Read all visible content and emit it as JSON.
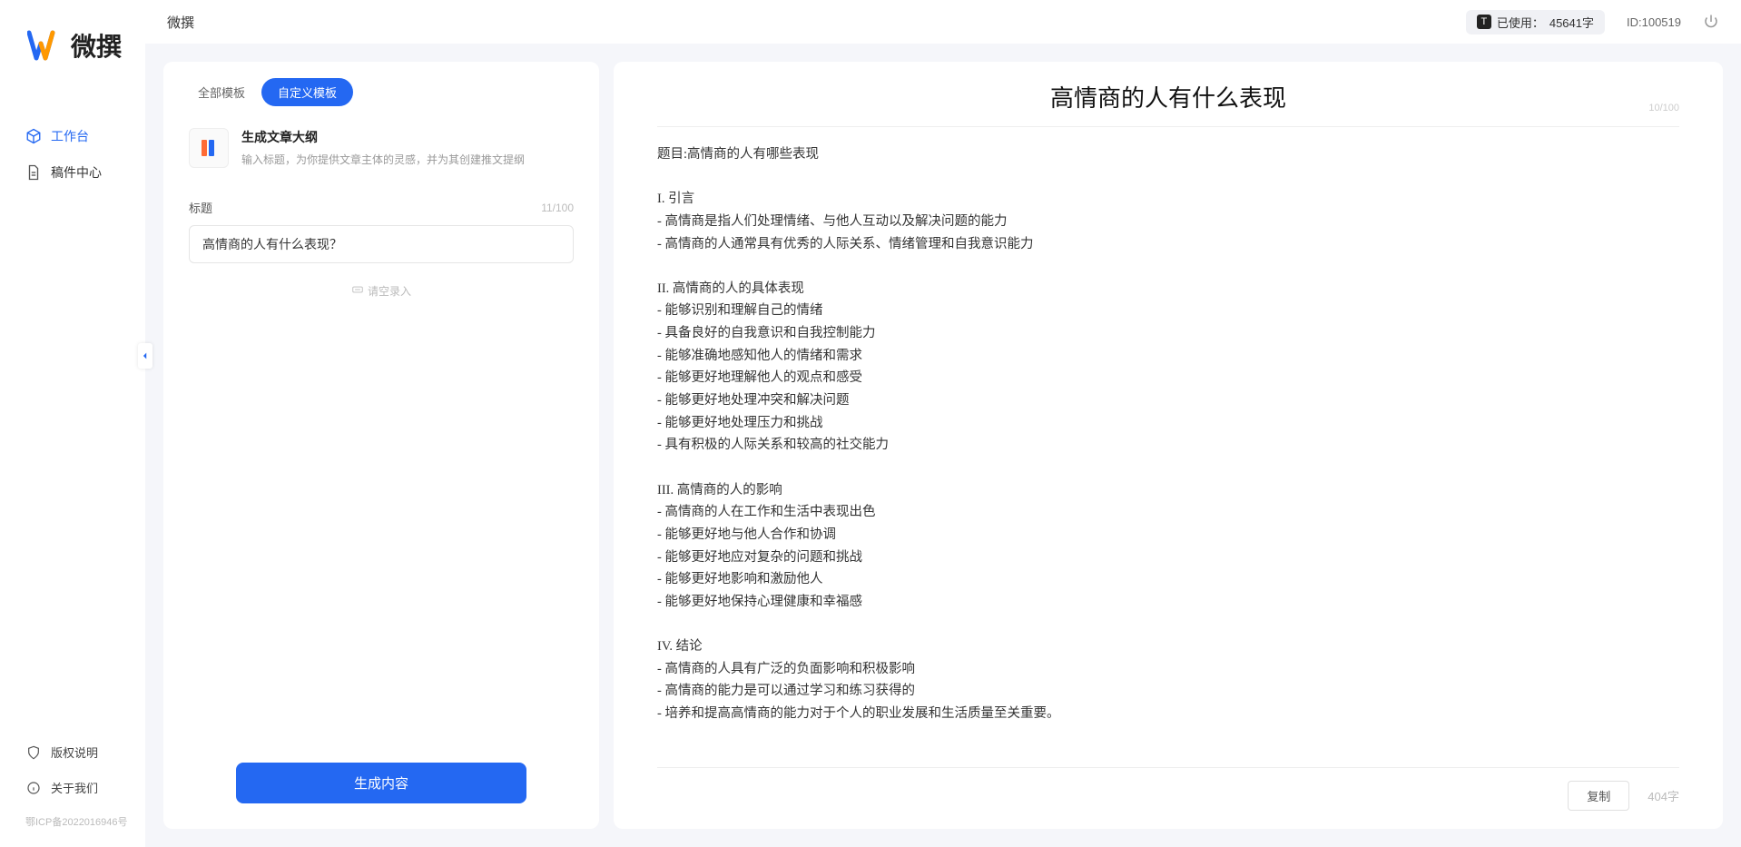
{
  "brand": {
    "name": "微撰"
  },
  "sidebar": {
    "nav": [
      {
        "label": "工作台",
        "active": true,
        "icon": "cube"
      },
      {
        "label": "稿件中心",
        "active": false,
        "icon": "doc"
      }
    ],
    "bottom": [
      {
        "label": "版权说明",
        "icon": "shield"
      },
      {
        "label": "关于我们",
        "icon": "info"
      }
    ],
    "icp": "鄂ICP备2022016946号"
  },
  "topbar": {
    "title": "微撰",
    "usage_prefix": "已使用：",
    "usage_value": "45641字",
    "userid": "ID:100519"
  },
  "left": {
    "tabs": [
      {
        "label": "全部模板",
        "active": false
      },
      {
        "label": "自定义模板",
        "active": true
      }
    ],
    "template": {
      "name": "生成文章大纲",
      "desc": "输入标题，为你提供文章主体的灵感，并为其创建推文提纲"
    },
    "title_label": "标题",
    "title_count": "11/100",
    "title_value": "高情商的人有什么表现？",
    "voice_hint": "请空录入",
    "generate_btn": "生成内容"
  },
  "right": {
    "title": "高情商的人有什么表现",
    "title_count": "10/100",
    "body": "题目:高情商的人有哪些表现\n\nI. 引言\n- 高情商是指人们处理情绪、与他人互动以及解决问题的能力\n- 高情商的人通常具有优秀的人际关系、情绪管理和自我意识能力\n\nII. 高情商的人的具体表现\n- 能够识别和理解自己的情绪\n- 具备良好的自我意识和自我控制能力\n- 能够准确地感知他人的情绪和需求\n- 能够更好地理解他人的观点和感受\n- 能够更好地处理冲突和解决问题\n- 能够更好地处理压力和挑战\n- 具有积极的人际关系和较高的社交能力\n\nIII. 高情商的人的影响\n- 高情商的人在工作和生活中表现出色\n- 能够更好地与他人合作和协调\n- 能够更好地应对复杂的问题和挑战\n- 能够更好地影响和激励他人\n- 能够更好地保持心理健康和幸福感\n\nIV. 结论\n- 高情商的人具有广泛的负面影响和积极影响\n- 高情商的能力是可以通过学习和练习获得的\n- 培养和提高高情商的能力对于个人的职业发展和生活质量至关重要。",
    "copy_btn": "复制",
    "word_count": "404字"
  }
}
